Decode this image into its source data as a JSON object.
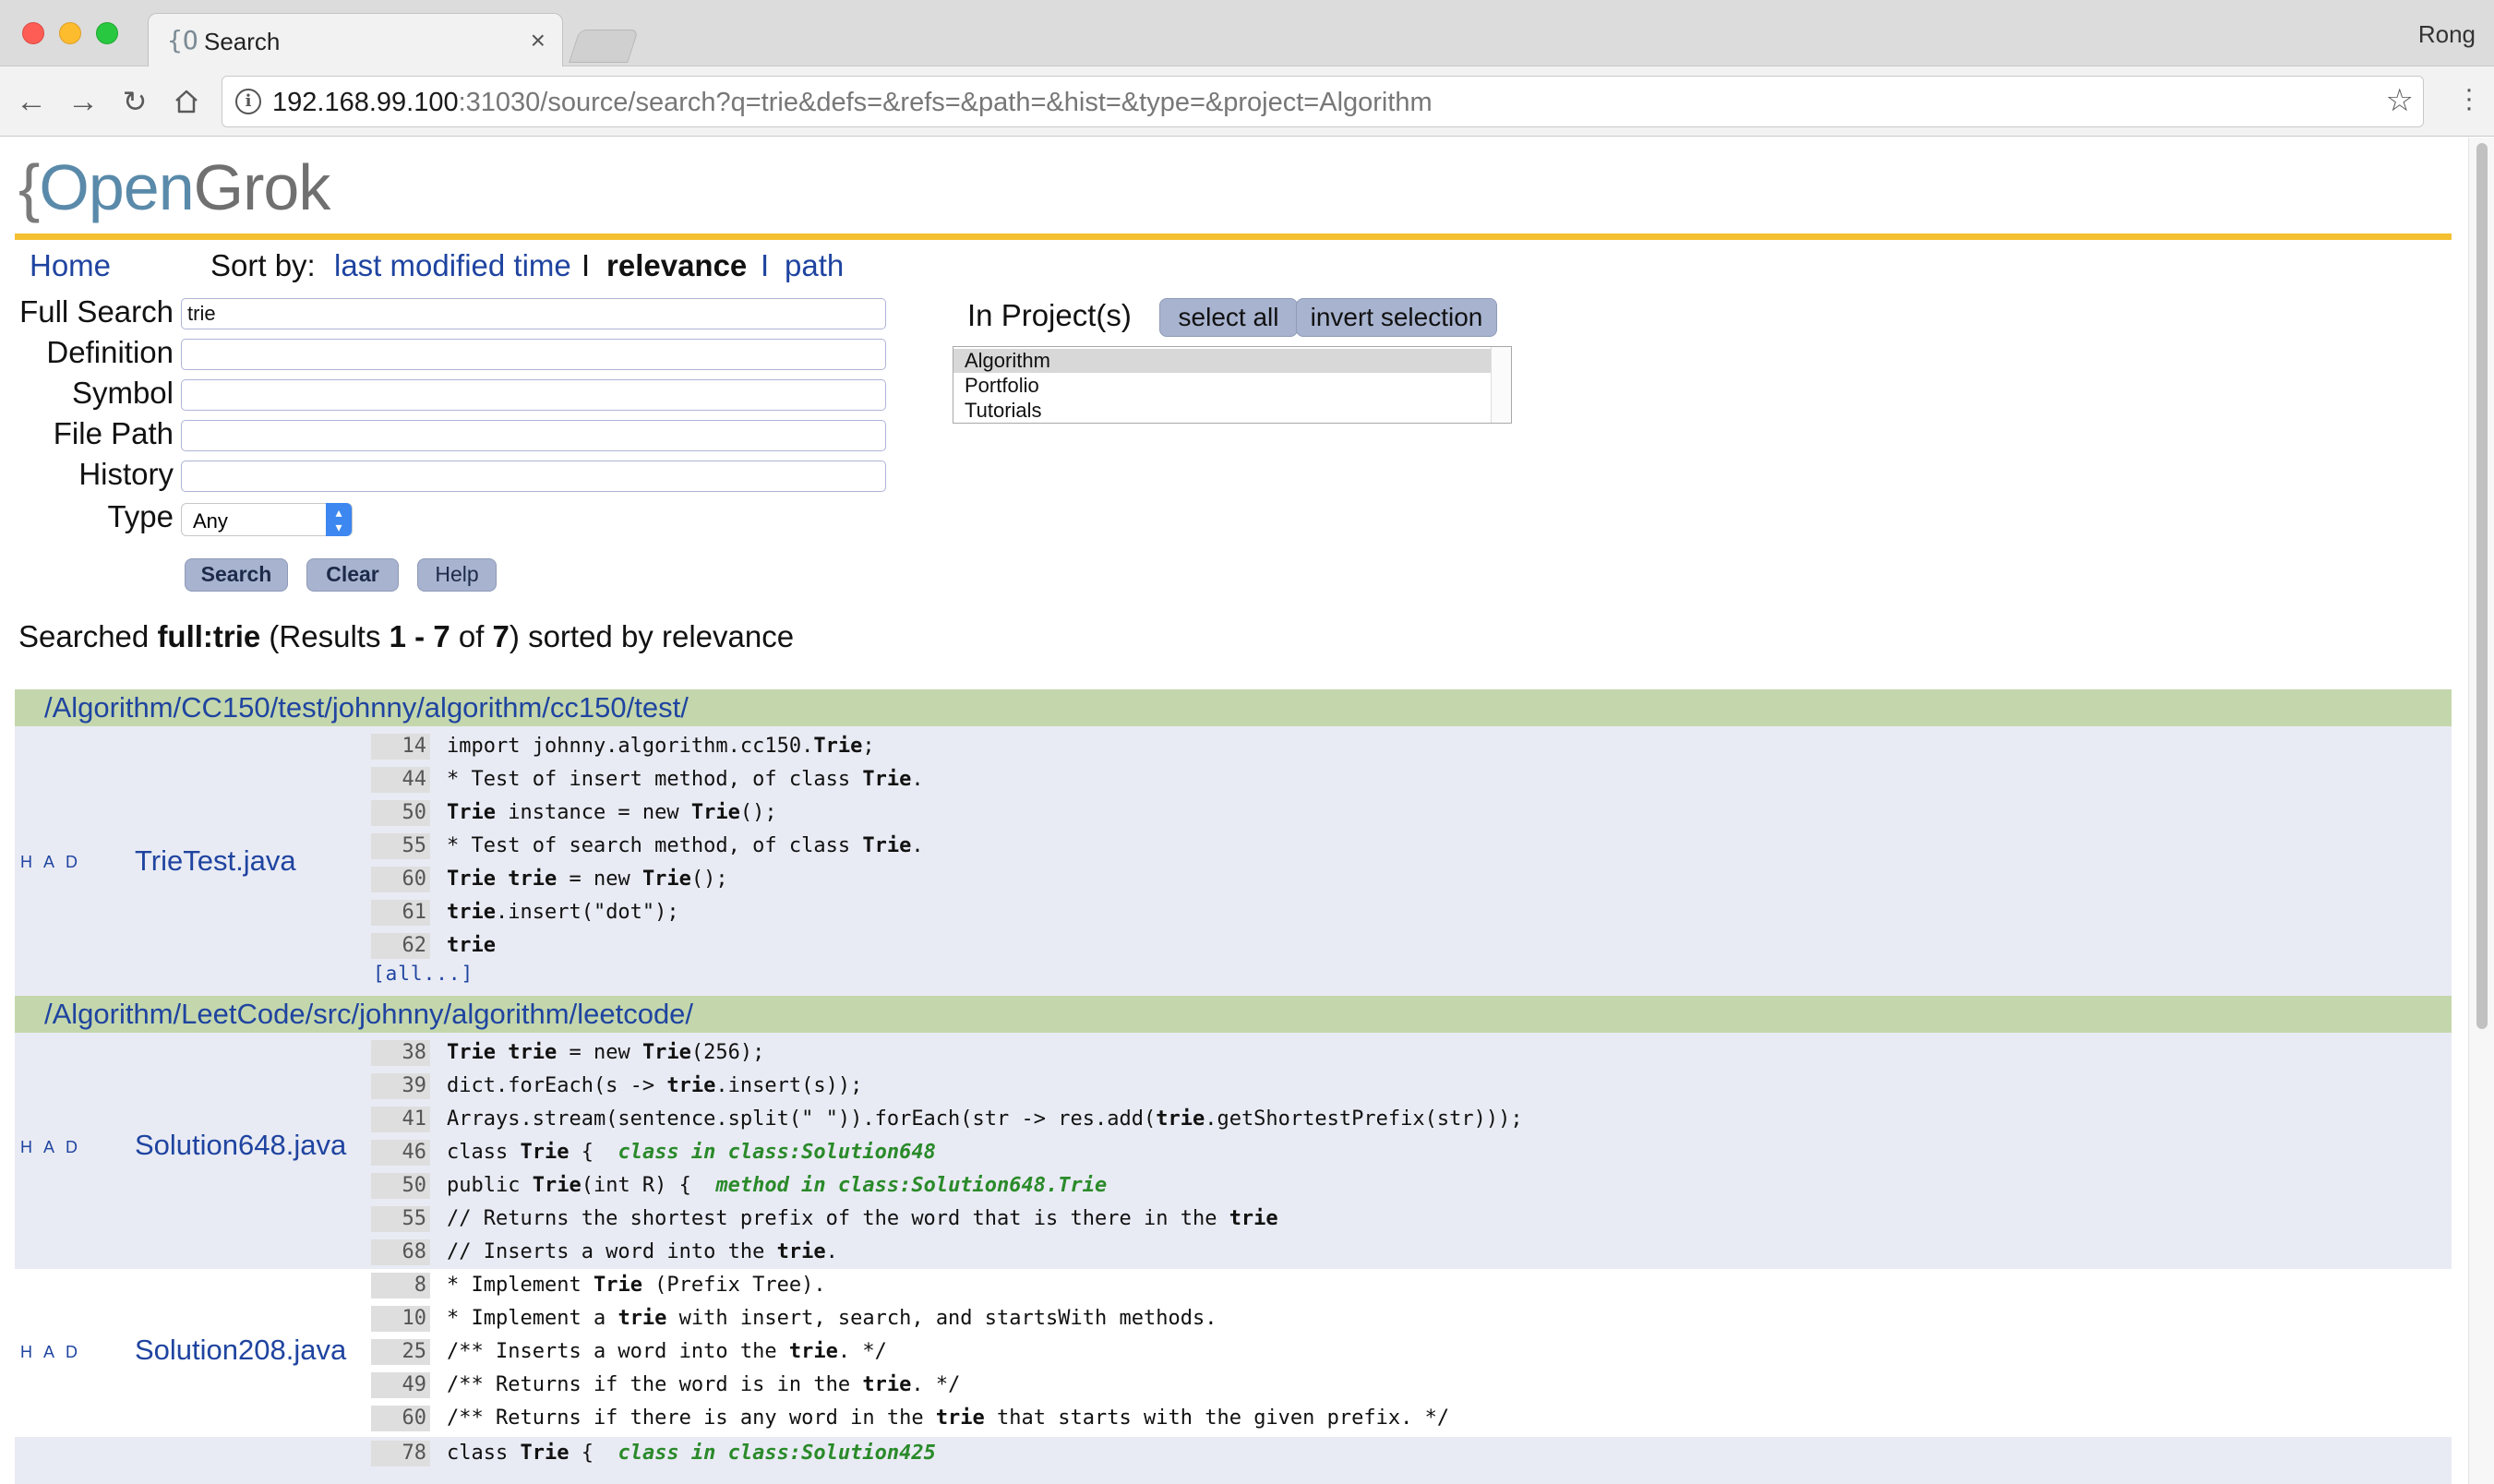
{
  "browser": {
    "tab_favicon": "{O",
    "tab_title": "Search",
    "tab_close": "×",
    "profile": "Rong",
    "url_host": "192.168.99.100",
    "url_rest": ":31030/source/search?q=trie&defs=&refs=&path=&hist=&type=&project=Algorithm"
  },
  "logo": {
    "brace": "{",
    "open": "Open",
    "grok": "Grok"
  },
  "menu": {
    "home": "Home",
    "sort_by": "Sort by:",
    "last_modified": "last modified time",
    "sep": "I",
    "relevance": "relevance",
    "sep2": "I",
    "path": "path"
  },
  "form": {
    "full_search_label": "Full Search",
    "full_search_value": "trie",
    "definition_label": "Definition",
    "symbol_label": "Symbol",
    "file_path_label": "File Path",
    "history_label": "History",
    "type_label": "Type",
    "type_value": "Any",
    "search_btn": "Search",
    "clear_btn": "Clear",
    "help_btn": "Help"
  },
  "projects": {
    "label": "In Project(s)",
    "select_all": "select all",
    "invert": "invert selection",
    "items": [
      "Algorithm",
      "Portfolio",
      "Tutorials"
    ],
    "selected": "Algorithm"
  },
  "summary": {
    "prefix": "Searched ",
    "query": "full:trie",
    "mid1": " (Results ",
    "range": "1 - 7",
    "mid2": " of ",
    "total": "7",
    "suffix": ") sorted by relevance"
  },
  "results": {
    "dir1": "/Algorithm/CC150/test/johnny/algorithm/cc150/test/",
    "dir2": "/Algorithm/LeetCode/src/johnny/algorithm/leetcode/",
    "had": "H A D",
    "all_link": "[all...]",
    "files": [
      {
        "name": "TrieTest.java",
        "lines": [
          {
            "n": "14",
            "html": "import johnny.algorithm.cc150.<b>Trie</b>;"
          },
          {
            "n": "44",
            "html": "* Test of insert method, of class <b>Trie</b>."
          },
          {
            "n": "50",
            "html": "<b>Trie</b> instance = new <b>Trie</b>();"
          },
          {
            "n": "55",
            "html": "* Test of search method, of class <b>Trie</b>."
          },
          {
            "n": "60",
            "html": "<b>Trie</b> <b>trie</b> = new <b>Trie</b>();"
          },
          {
            "n": "61",
            "html": "<b>trie</b>.insert(\"dot\");"
          },
          {
            "n": "62",
            "html": "<b>trie</b>"
          }
        ]
      },
      {
        "name": "Solution648.java",
        "lines": [
          {
            "n": "38",
            "html": "<b>Trie</b> <b>trie</b> = new <b>Trie</b>(256);"
          },
          {
            "n": "39",
            "html": "dict.forEach(s -> <b>trie</b>.insert(s));"
          },
          {
            "n": "41",
            "html": "Arrays.stream(sentence.split(\" \")).forEach(str -> res.add(<b>trie</b>.getShortestPrefix(str)));"
          },
          {
            "n": "46",
            "html": "class <b>Trie</b> {  <i>class in class:Solution648</i>"
          },
          {
            "n": "50",
            "html": "public <b>Trie</b>(int R) {  <i>method in class:Solution648.Trie</i>"
          },
          {
            "n": "55",
            "html": "// Returns the shortest prefix of the word that is there in the <b>trie</b>"
          },
          {
            "n": "68",
            "html": "// Inserts a word into the <b>trie</b>."
          }
        ]
      },
      {
        "name": "Solution208.java",
        "lines": [
          {
            "n": "8",
            "html": "* Implement <b>Trie</b> (Prefix Tree)."
          },
          {
            "n": "10",
            "html": "* Implement a <b>trie</b> with insert, search, and startsWith methods."
          },
          {
            "n": "25",
            "html": "/** Inserts a word into the <b>trie</b>. */"
          },
          {
            "n": "49",
            "html": "/** Returns if the word is in the <b>trie</b>. */"
          },
          {
            "n": "60",
            "html": "/** Returns if there is any word in the <b>trie</b> that starts with the given prefix. */"
          }
        ]
      },
      {
        "name": "",
        "lines": [
          {
            "n": "78",
            "html": "class <b>Trie</b> {  <i>class in class:Solution425</i>"
          }
        ]
      }
    ]
  }
}
